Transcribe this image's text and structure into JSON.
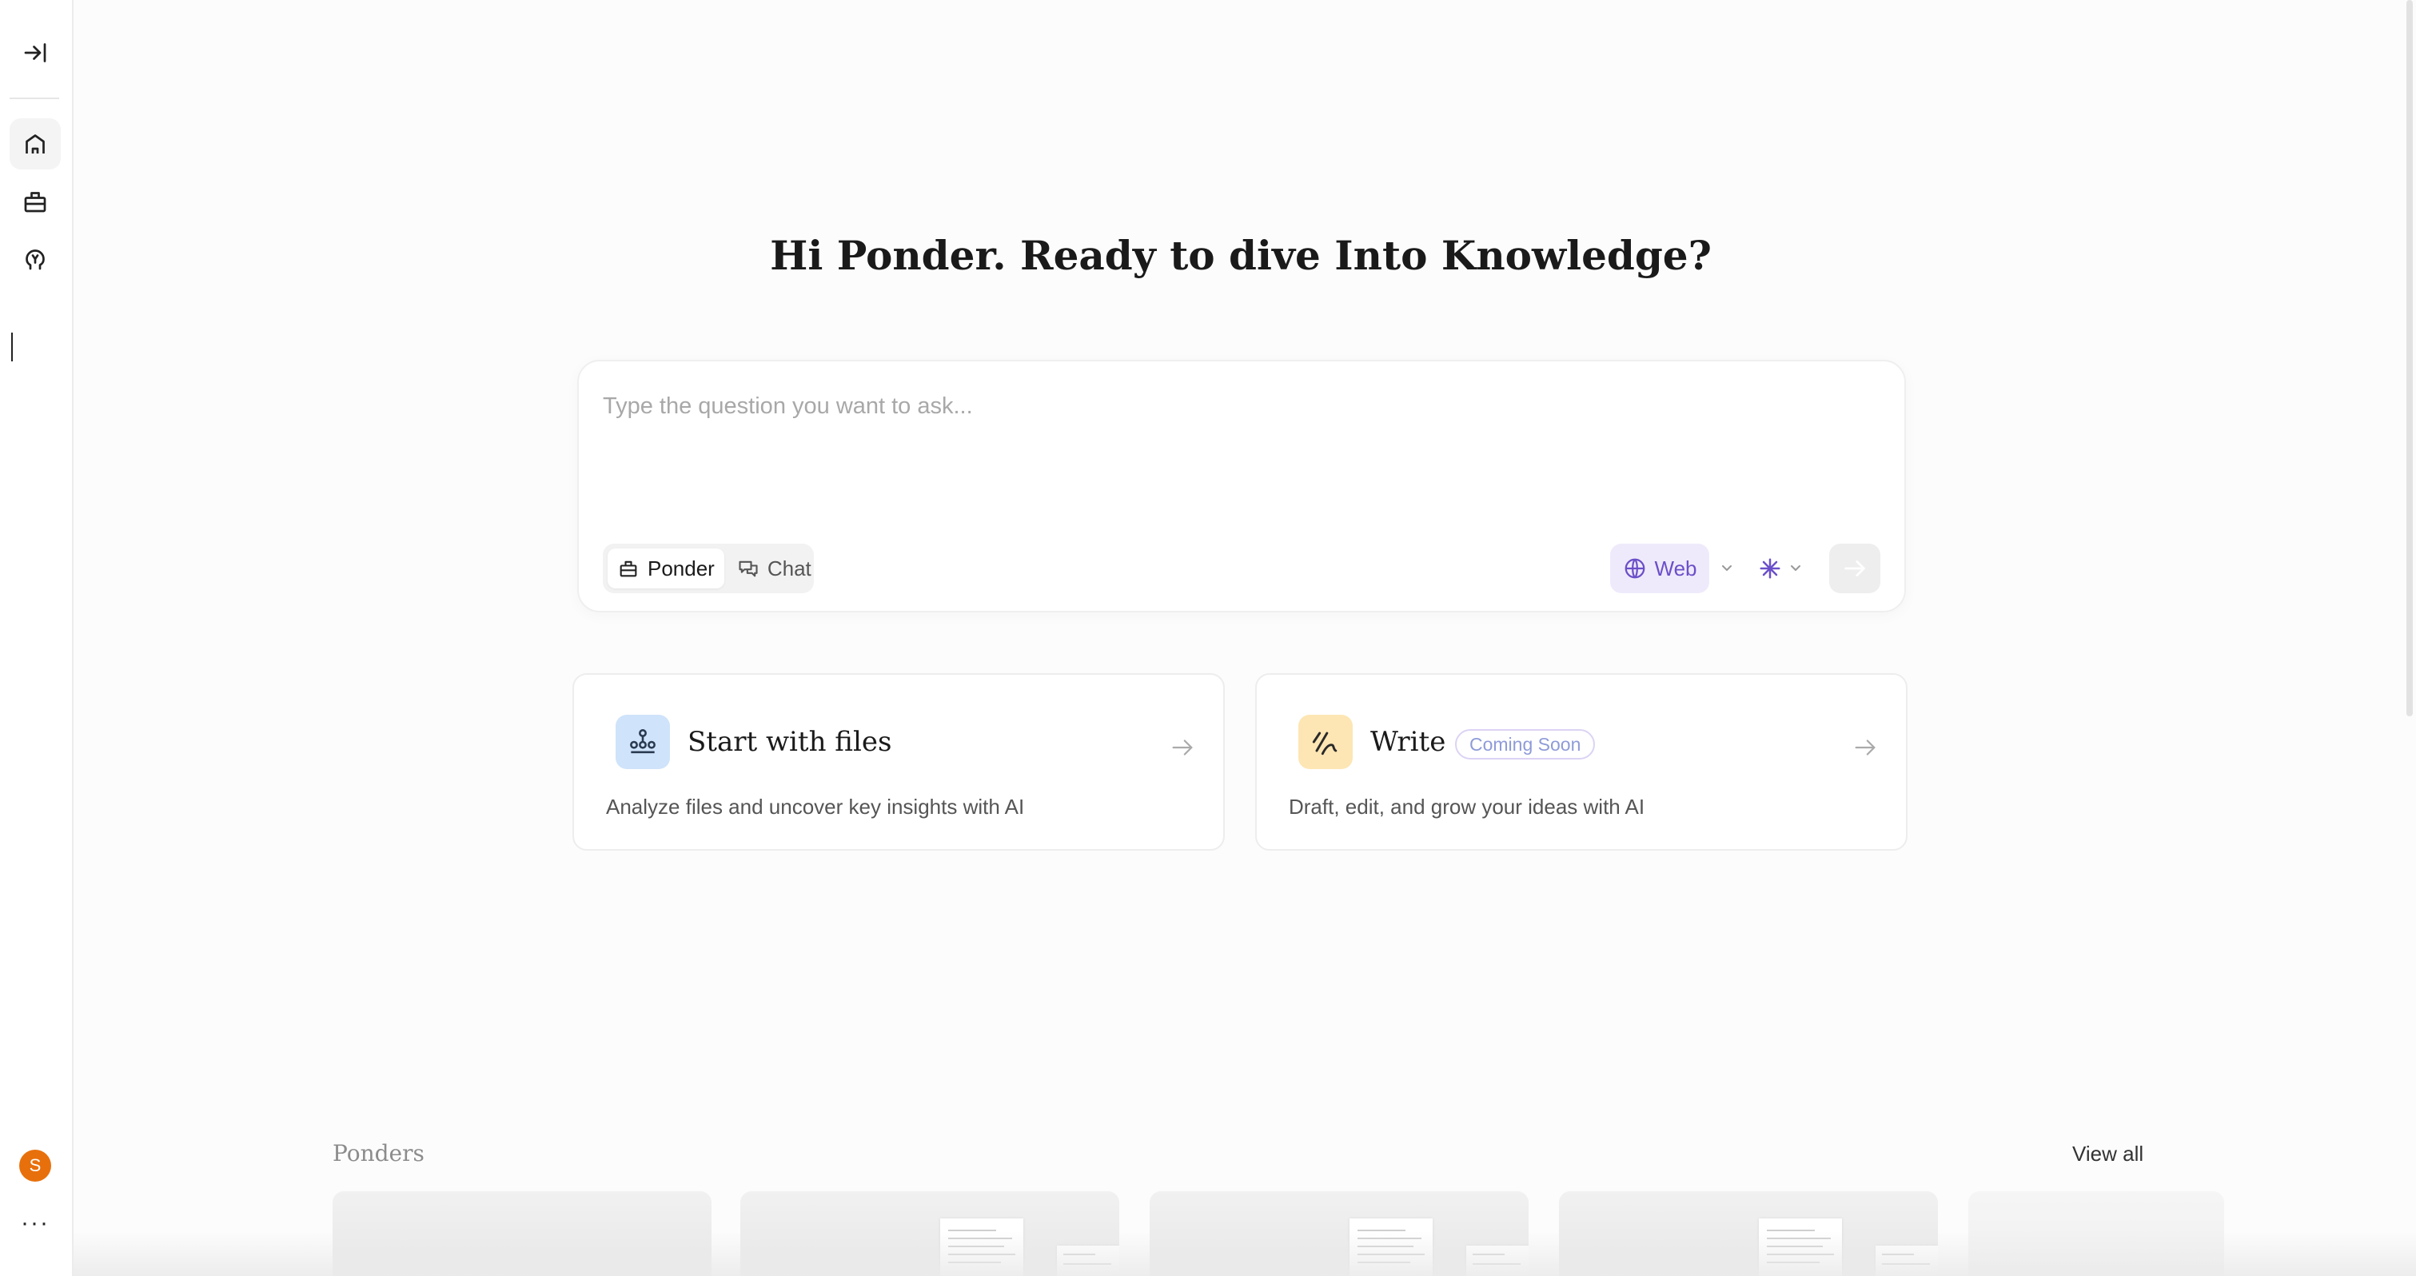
{
  "sidebar": {
    "items": [
      {
        "name": "collapse-sidebar",
        "icon": "collapse-sidebar-icon"
      },
      {
        "name": "home",
        "icon": "home-icon"
      },
      {
        "name": "ponder",
        "icon": "ponder-icon"
      },
      {
        "name": "knowledge",
        "icon": "brain-icon"
      }
    ],
    "avatar_initial": "S",
    "more_label": "···"
  },
  "heading": "Hi Ponder. Ready to dive Into Knowledge?",
  "ask": {
    "placeholder": "Type the question you want to ask...",
    "modes": [
      {
        "label": "Ponder",
        "active": true
      },
      {
        "label": "Chat",
        "active": false
      }
    ],
    "web_label": "Web"
  },
  "cards": [
    {
      "title": "Start with files",
      "description": "Analyze files and uncover key insights with AI",
      "badge": "",
      "icon": "files-icon"
    },
    {
      "title": "Write",
      "description": "Draft, edit, and grow your ideas with AI",
      "badge": "Coming Soon",
      "icon": "write-icon"
    }
  ],
  "ponders": {
    "label": "Ponders",
    "view_all": "View all"
  },
  "colors": {
    "accent": "#6b4fc9",
    "avatar": "#e8700c",
    "files_icon_bg": "#cfe3fa",
    "write_icon_bg": "#fde6b4"
  }
}
